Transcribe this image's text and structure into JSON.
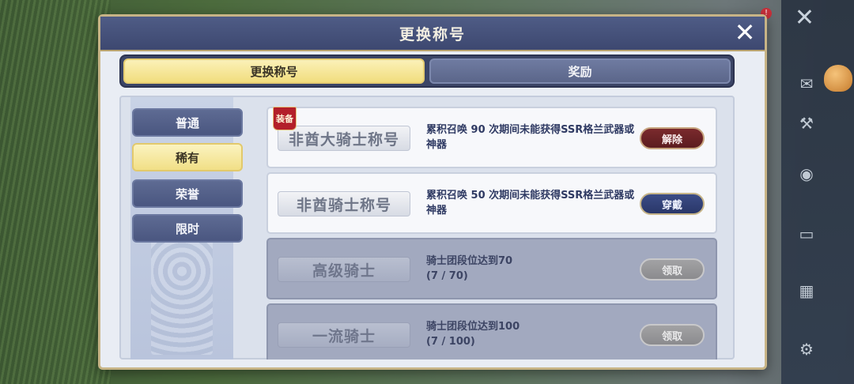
{
  "dialog": {
    "title": "更换称号"
  },
  "tabs": [
    {
      "label": "更换称号",
      "active": true
    },
    {
      "label": "奖励",
      "active": false
    }
  ],
  "categories": [
    {
      "label": "普通",
      "active": false
    },
    {
      "label": "稀有",
      "active": true
    },
    {
      "label": "荣誉",
      "active": false
    },
    {
      "label": "限时",
      "active": false
    }
  ],
  "titles": [
    {
      "name": "非酋大骑士称号",
      "equipped_tag": "装备",
      "desc": "累积召唤 90 次期间未能获得SSR格兰武器或神器",
      "button": "解除",
      "state": "equipped"
    },
    {
      "name": "非酋骑士称号",
      "equipped_tag": "",
      "desc": "累积召唤 50 次期间未能获得SSR格兰武器或神器",
      "button": "穿戴",
      "state": "owned"
    },
    {
      "name": "高级骑士",
      "equipped_tag": "",
      "desc": "骑士团段位达到70",
      "progress": "(7 / 70)",
      "button": "领取",
      "state": "locked"
    },
    {
      "name": "一流骑士",
      "equipped_tag": "",
      "desc": "骑士团段位达到100",
      "progress": "(7 / 100)",
      "button": "领取",
      "state": "locked"
    }
  ],
  "hud": {
    "notification_count": "!"
  },
  "colors": {
    "header": "#3d4870",
    "active_tab": "#f1dd7e",
    "remove_button": "#5c1c1f",
    "wear_button": "#2a3769",
    "claim_button": "#8b8b8e"
  }
}
